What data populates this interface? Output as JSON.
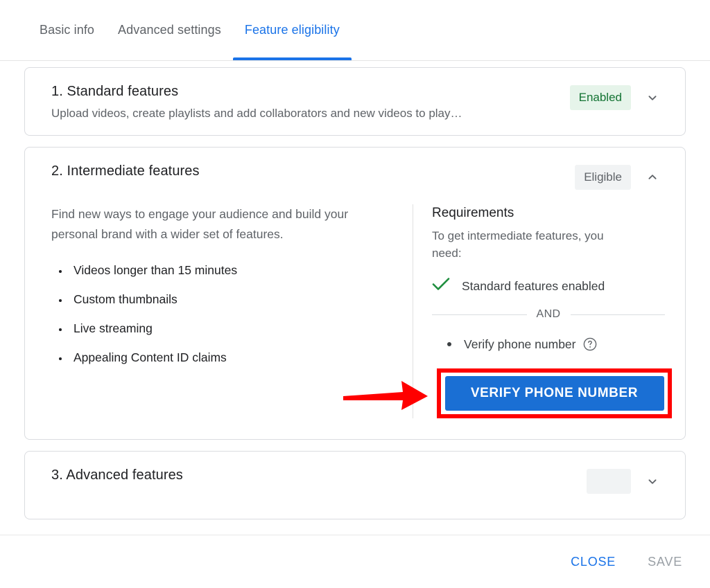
{
  "tabs": [
    {
      "label": "Basic info",
      "active": false
    },
    {
      "label": "Advanced settings",
      "active": false
    },
    {
      "label": "Feature eligibility",
      "active": true
    }
  ],
  "cards": [
    {
      "title": "1. Standard features",
      "subtitle": "Upload videos, create playlists and add collaborators and new videos to play…",
      "badge": "Enabled",
      "badge_style": "enabled",
      "chevron": "chevron-down-icon"
    },
    {
      "title": "2. Intermediate features",
      "badge": "Eligible",
      "badge_style": "eligible",
      "chevron": "chevron-up-icon",
      "description": "Find new ways to engage your audience and build your personal brand with a wider set of features.",
      "features": [
        "Videos longer than 15 minutes",
        "Custom thumbnails",
        "Live streaming",
        "Appealing Content ID claims"
      ],
      "requirements": {
        "heading": "Requirements",
        "intro": "To get intermediate features, you need:",
        "completed": "Standard features enabled",
        "conjunction": "AND",
        "pending": "Verify phone number",
        "action_label": "VERIFY PHONE NUMBER"
      }
    },
    {
      "title": "3. Advanced features",
      "badge": "",
      "badge_style": "eligible"
    }
  ],
  "footer": {
    "close_label": "CLOSE",
    "save_label": "SAVE"
  },
  "colors": {
    "accent": "#1a73e8",
    "button": "#1a6fd4",
    "annotation": "#ff0000",
    "success": "#1e8e3e",
    "badge_enabled_bg": "#e6f4ea",
    "badge_enabled_text": "#137333",
    "badge_eligible_bg": "#f1f3f4"
  }
}
